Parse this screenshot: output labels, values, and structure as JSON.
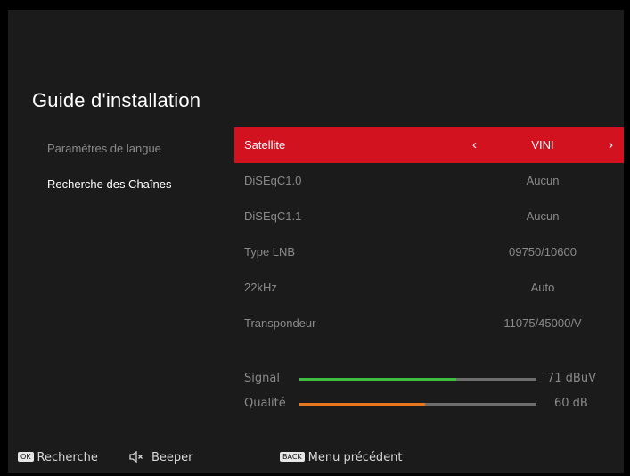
{
  "title": "Guide d'installation",
  "left_menu": [
    {
      "label": "Paramètres de langue",
      "active": false
    },
    {
      "label": "Recherche des Chaînes",
      "active": true
    }
  ],
  "settings": [
    {
      "label": "Satellite",
      "value": "VINI",
      "selected": true
    },
    {
      "label": "DiSEqC1.0",
      "value": "Aucun"
    },
    {
      "label": "DiSEqC1.1",
      "value": "Aucun"
    },
    {
      "label": "Type LNB",
      "value": "09750/10600"
    },
    {
      "label": "22kHz",
      "value": "Auto"
    },
    {
      "label": "Transpondeur",
      "value": "11075/45000/V"
    }
  ],
  "arrows": {
    "left": "‹",
    "right": "›"
  },
  "signal": {
    "label": "Signal",
    "value": "71 dBuV",
    "level": 0.66,
    "color": "#3fbf3f"
  },
  "quality": {
    "label": "Qualité",
    "value": "60 dB",
    "level": 0.53,
    "color": "#e8761c"
  },
  "footer": {
    "ok_key": "OK",
    "ok_label": "Recherche",
    "beeper_icon": "speaker-muted-icon",
    "beeper_label": "Beeper",
    "back_key": "BACK",
    "back_label": "Menu précédent"
  },
  "colors": {
    "accent": "#d2121f",
    "background": "#1b1b1b"
  }
}
